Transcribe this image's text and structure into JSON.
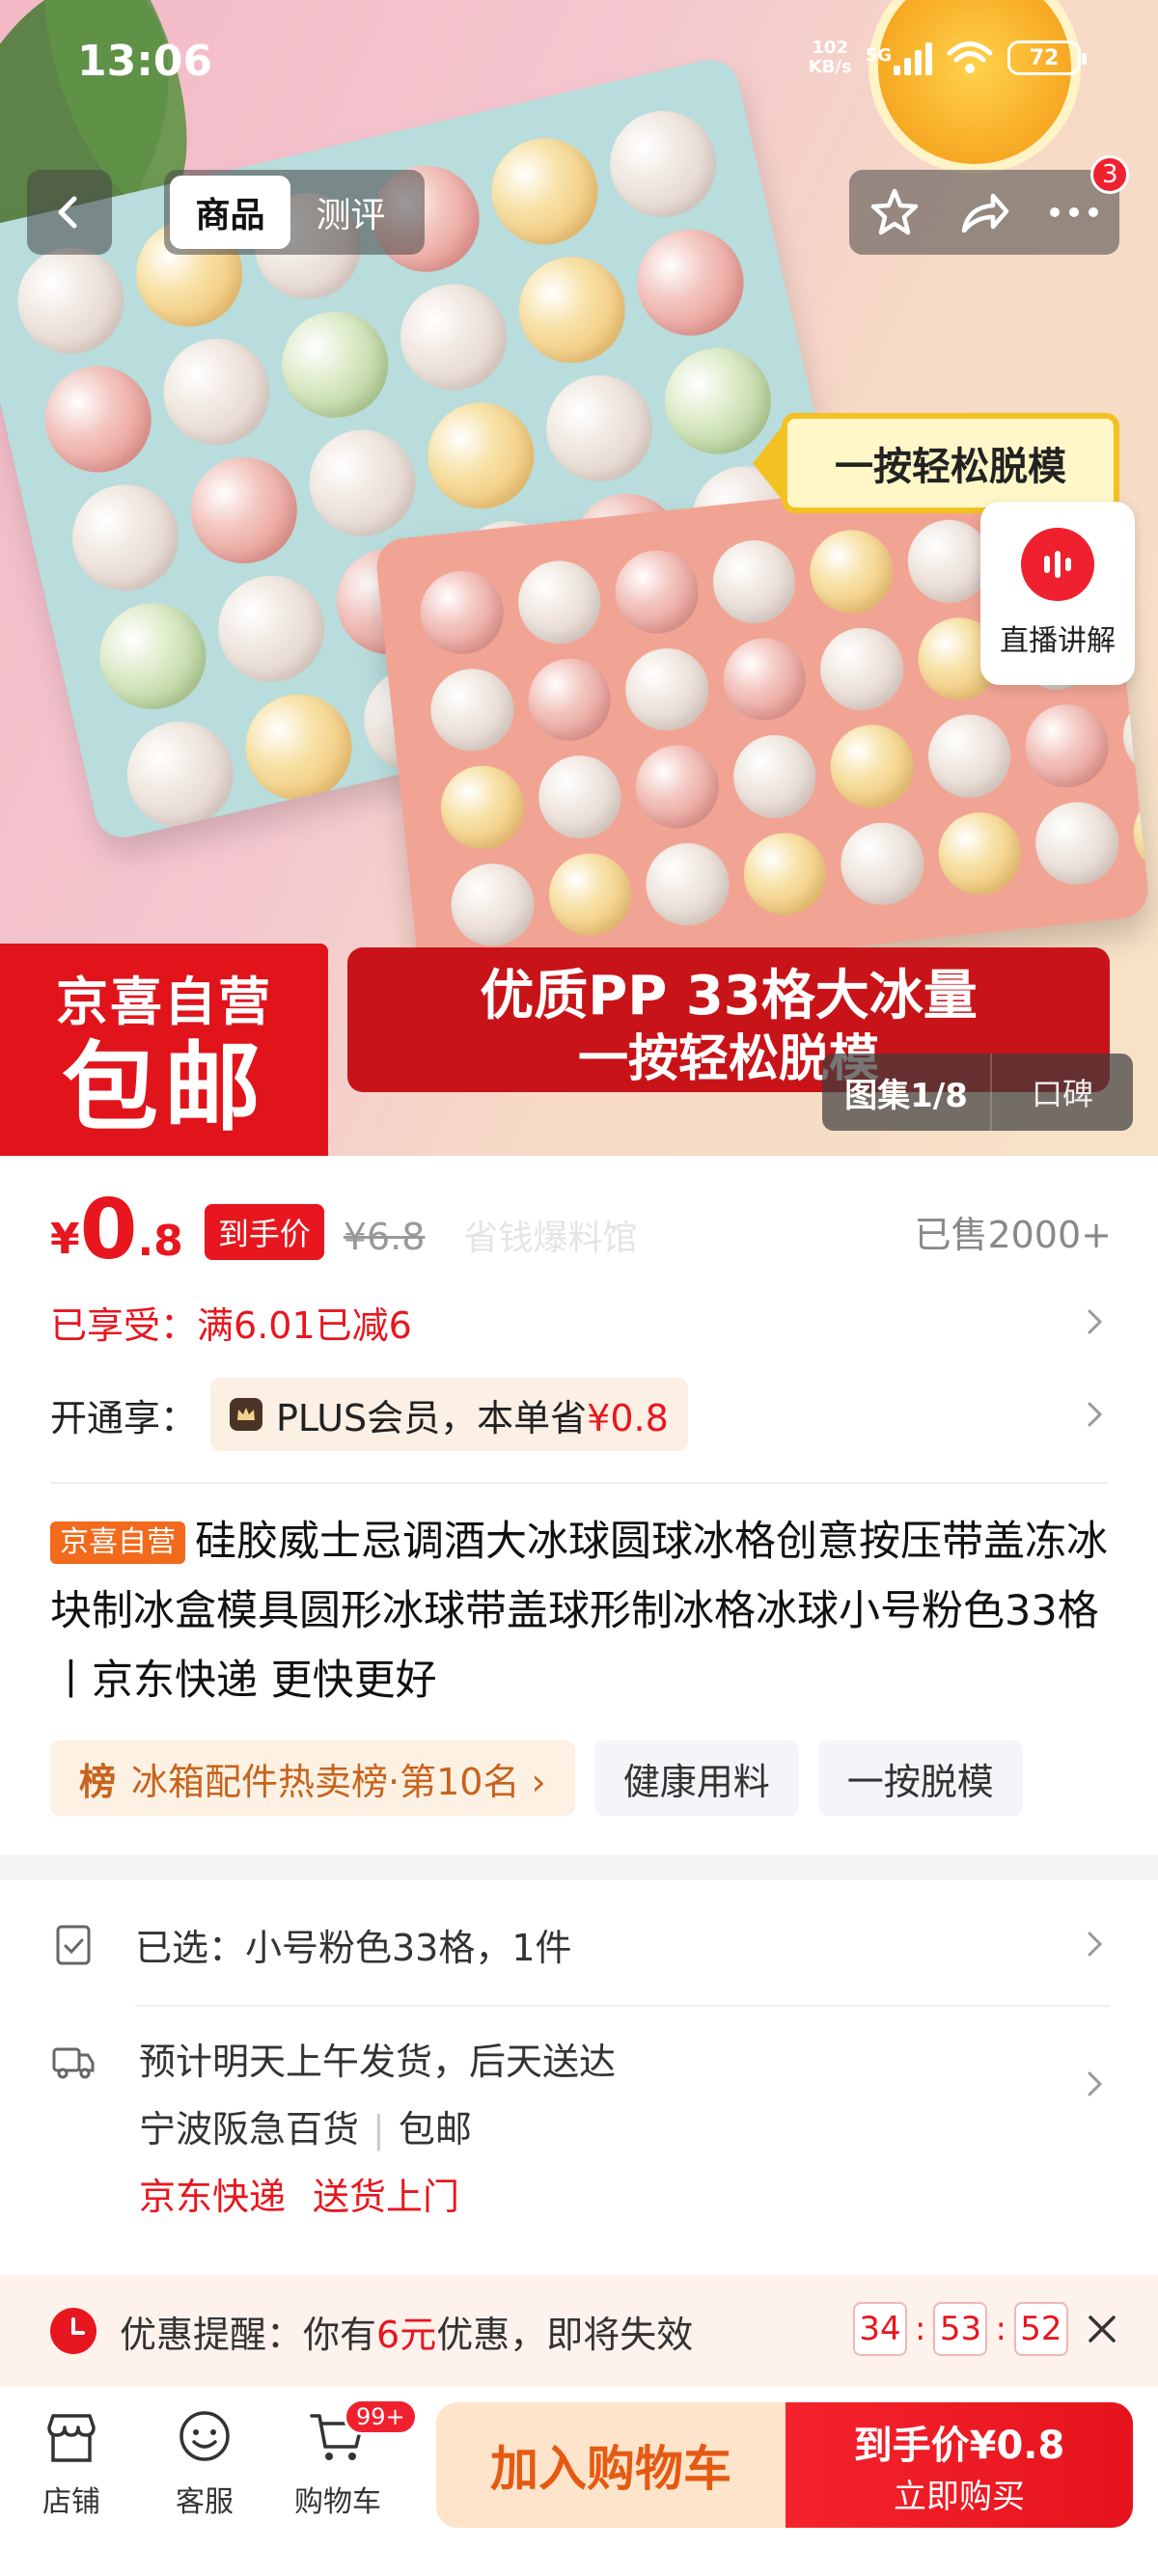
{
  "status_bar": {
    "time": "13:06",
    "net_rate": "102",
    "net_unit": "KB/s",
    "network": "5G",
    "battery": "72"
  },
  "nav": {
    "tabs": [
      {
        "label": "商品",
        "active": true
      },
      {
        "label": "测评",
        "active": false
      }
    ],
    "actions": [
      {
        "icon": "star-icon"
      },
      {
        "icon": "share-icon"
      },
      {
        "icon": "more-icon",
        "badge": "3"
      }
    ]
  },
  "hero": {
    "arrow_text": "一按轻松脱模",
    "banner_left_line1": "京喜自营",
    "banner_left_line2": "包邮",
    "banner_right_line1": "优质PP 33格大冰量",
    "banner_right_line2": "一按轻松脱模",
    "live_label": "直播讲解",
    "gallery_label": "图集1/8",
    "reviews_label": "口碑"
  },
  "price": {
    "currency": "¥",
    "integer": "0",
    "decimal": ".8",
    "tag": "到手价",
    "original": "¥6.8",
    "watermark": "省钱爆料馆",
    "sold": "已售2000+"
  },
  "enjoyed": {
    "label": "已享受：",
    "text": "满6.01已减6"
  },
  "plus": {
    "label": "开通享：",
    "text": "PLUS会员，本单省",
    "value": "¥0.8"
  },
  "product": {
    "store_tag": "京喜自营",
    "title": "硅胶威士忌调酒大冰球圆球冰格创意按压带盖冻冰块制冰盒模具圆形冰球带盖球形制冰格冰球小号粉色33格丨京东快递 更快更好"
  },
  "chips": [
    {
      "prefix": "榜",
      "label": "冰箱配件热卖榜·第10名 ›",
      "type": "rank"
    },
    {
      "label": "健康用料",
      "type": "plain"
    },
    {
      "label": "一按脱模",
      "type": "plain"
    }
  ],
  "selection": {
    "text": "已选：小号粉色33格，1件"
  },
  "shipping": {
    "line1": "预计明天上午发货，后天送达",
    "store": "宁波阪急百货",
    "free": "包邮",
    "tags": [
      "京东快递",
      "送货上门"
    ]
  },
  "promo": {
    "prefix": "优惠提醒：你有",
    "amount": "6元",
    "suffix": "优惠，即将失效",
    "timer": [
      "34",
      "53",
      "52"
    ]
  },
  "bottom_bar": {
    "store": "店铺",
    "service": "客服",
    "cart": "购物车",
    "cart_badge": "99+",
    "add_to_cart": "加入购物车",
    "buy_line1": "到手价¥0.8",
    "buy_line2": "立即购买"
  },
  "colors": {
    "accent_red": "#e8161e",
    "cart_orange": "#e55a12",
    "cart_bg": "#fde4cb"
  }
}
